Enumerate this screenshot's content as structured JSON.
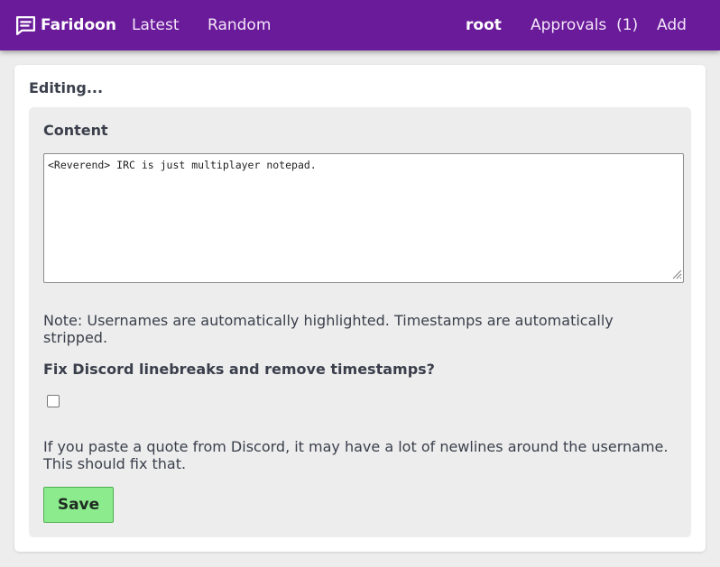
{
  "navbar": {
    "brand": "Faridoon",
    "brand_icon": "message-square-icon",
    "latest": "Latest",
    "random": "Random",
    "user": "root",
    "approvals": "Approvals",
    "approvals_count": "(1)",
    "add": "Add",
    "background_color": "#6a1b9a"
  },
  "editor": {
    "title": "Editing...",
    "content_label": "Content",
    "content_value": "<Reverend> IRC is just multiplayer notepad.",
    "note": "Note: Usernames are automatically highlighted. Timestamps are automatically stripped.",
    "fix_label": "Fix Discord linebreaks and remove timestamps?",
    "fix_checked": false,
    "help": "If you paste a quote from Discord, it may have a lot of newlines around the username. This should fix that.",
    "save_label": "Save",
    "save_color": "#8ceb8c"
  }
}
